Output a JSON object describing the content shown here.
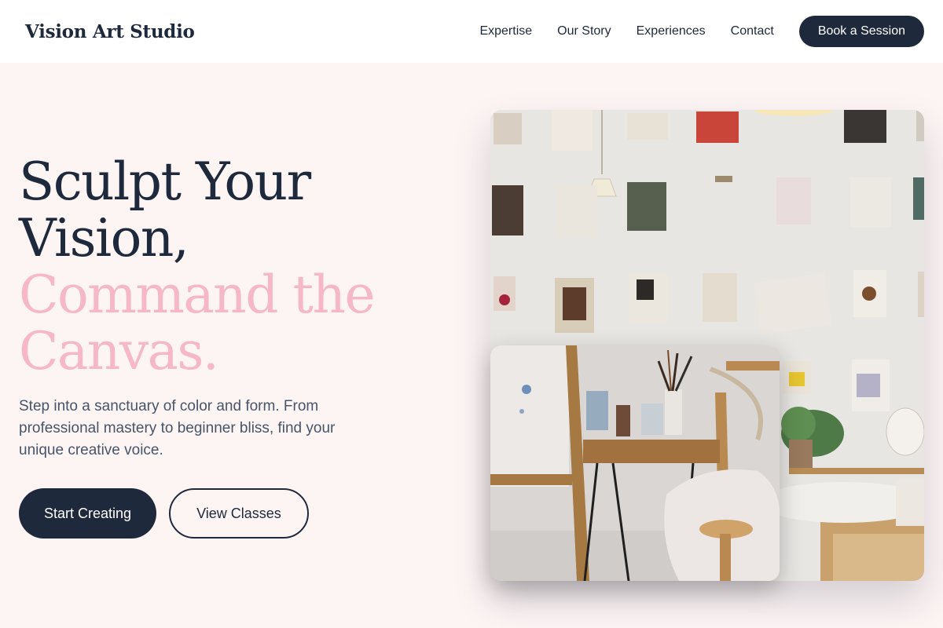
{
  "header": {
    "brand": "Vision Art Studio",
    "nav": [
      "Expertise",
      "Our Story",
      "Experiences",
      "Contact"
    ],
    "cta_label": "Book a Session"
  },
  "hero": {
    "headline_line1": "Sculpt Your",
    "headline_line2": "Vision,",
    "headline_line3": "Command the",
    "headline_line4": "Canvas.",
    "lead": "Step into a sanctuary of color and form. From professional mastery to beginner bliss, find your unique creative voice.",
    "primary_button": "Start Creating",
    "secondary_button": "View Classes"
  },
  "images": {
    "main_alt": "studio-wall-with-clipboards",
    "inset_alt": "artist-easel-and-brushes"
  },
  "colors": {
    "navy": "#1e293b",
    "pink_accent": "#f6b8c7",
    "page_bg": "#fdf4f4",
    "body_text": "#475569"
  }
}
